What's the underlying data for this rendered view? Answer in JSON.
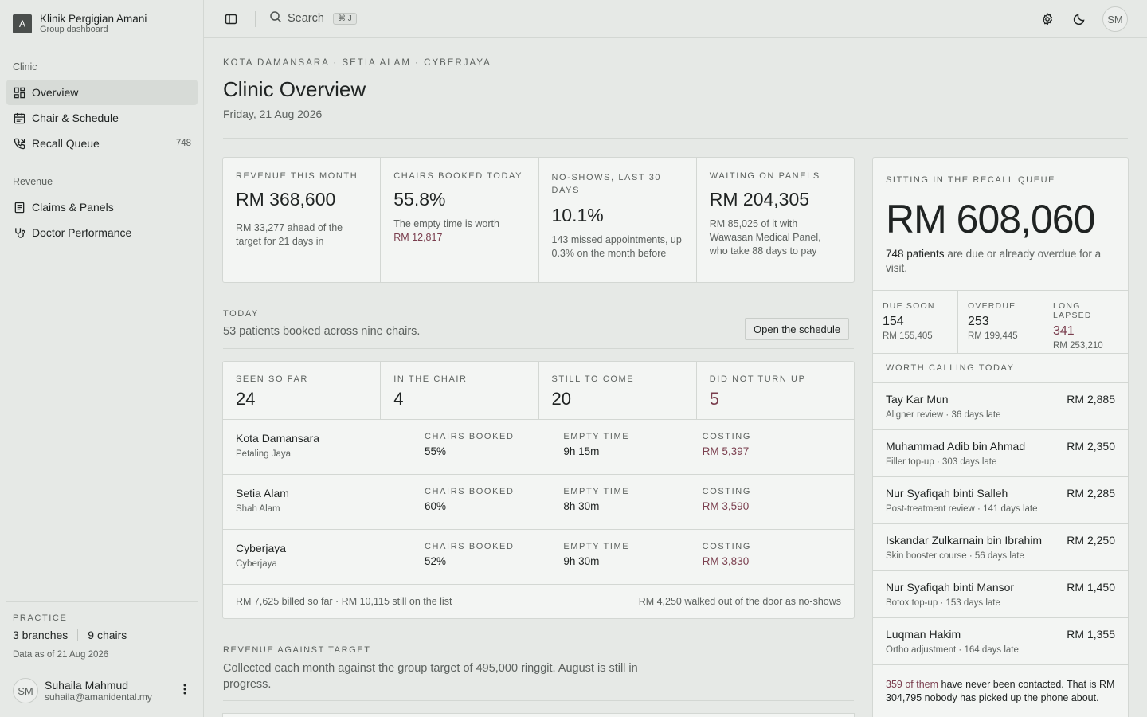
{
  "brand": {
    "logo_letter": "A",
    "name": "Klinik Pergigian Amani",
    "subtitle": "Group dashboard"
  },
  "sidebar": {
    "sections": [
      {
        "heading": "Clinic",
        "items": [
          {
            "label": "Overview",
            "icon": "grid-icon",
            "active": true
          },
          {
            "label": "Chair & Schedule",
            "icon": "calendar-icon"
          },
          {
            "label": "Recall Queue",
            "icon": "phone-icon",
            "count": "748"
          }
        ]
      },
      {
        "heading": "Revenue",
        "items": [
          {
            "label": "Claims & Panels",
            "icon": "document-icon"
          },
          {
            "label": "Doctor Performance",
            "icon": "stethoscope-icon"
          }
        ]
      }
    ],
    "practice": {
      "heading": "PRACTICE",
      "branches": "3 branches",
      "chairs": "9 chairs",
      "as_of": "Data as of 21 Aug 2026"
    },
    "user": {
      "initials": "SM",
      "name": "Suhaila Mahmud",
      "email": "suhaila@amanidental.my"
    }
  },
  "topbar": {
    "search_label": "Search",
    "shortcut": "⌘ J",
    "avatar_initials": "SM"
  },
  "page": {
    "breadcrumb": "KOTA DAMANSARA · SETIA ALAM · CYBERJAYA",
    "title": "Clinic Overview",
    "date": "Friday, 21 Aug 2026"
  },
  "kpis": [
    {
      "label": "REVENUE THIS MONTH",
      "value": "RM 368,600",
      "note": "RM 33,277 ahead of the target for 21 days in"
    },
    {
      "label": "CHAIRS BOOKED TODAY",
      "value": "55.8%",
      "note": "The empty time is worth",
      "note_accent": "RM 12,817"
    },
    {
      "label": "NO-SHOWS, LAST 30 DAYS",
      "value": "10.1%",
      "note": "143 missed appointments, up 0.3% on the month before"
    },
    {
      "label": "WAITING ON PANELS",
      "value": "RM 204,305",
      "note": "RM 85,025 of it with Wawasan Medical Panel, who take 88 days to pay"
    }
  ],
  "today": {
    "label": "TODAY",
    "subtitle": "53 patients booked across nine chairs.",
    "button": "Open the schedule",
    "stats": [
      {
        "label": "SEEN SO FAR",
        "value": "24"
      },
      {
        "label": "IN THE CHAIR",
        "value": "4"
      },
      {
        "label": "STILL TO COME",
        "value": "20"
      },
      {
        "label": "DID NOT TURN UP",
        "value": "5"
      }
    ],
    "col_labels": {
      "booked": "CHAIRS BOOKED",
      "empty": "EMPTY TIME",
      "costing": "COSTING"
    },
    "branches": [
      {
        "name": "Kota Damansara",
        "area": "Petaling Jaya",
        "booked": "55%",
        "empty": "9h 15m",
        "costing": "RM 5,397"
      },
      {
        "name": "Setia Alam",
        "area": "Shah Alam",
        "booked": "60%",
        "empty": "8h 30m",
        "costing": "RM 3,590"
      },
      {
        "name": "Cyberjaya",
        "area": "Cyberjaya",
        "booked": "52%",
        "empty": "9h 30m",
        "costing": "RM 3,830"
      }
    ],
    "footer_left": "RM 7,625 billed so far · RM 10,115 still on the list",
    "footer_right": "RM 4,250 walked out of the door as no-shows"
  },
  "revenue": {
    "label": "REVENUE AGAINST TARGET",
    "subtitle": "Collected each month against the group target of 495,000 ringgit. August is still in progress."
  },
  "recall": {
    "label": "SITTING IN THE RECALL QUEUE",
    "amount": "RM 608,060",
    "patients": "748 patients",
    "desc": " are due or already overdue for a visit.",
    "buckets": [
      {
        "label": "DUE SOON",
        "count": "154",
        "amount": "RM 155,405"
      },
      {
        "label": "OVERDUE",
        "count": "253",
        "amount": "RM 199,445"
      },
      {
        "label": "LONG LAPSED",
        "count": "341",
        "amount": "RM 253,210"
      }
    ],
    "worth_label": "WORTH CALLING TODAY",
    "patients_list": [
      {
        "name": "Tay Kar Mun",
        "amount": "RM 2,885",
        "treatment": "Aligner review",
        "late": "36 days late"
      },
      {
        "name": "Muhammad Adib bin Ahmad",
        "amount": "RM 2,350",
        "treatment": "Filler top-up",
        "late": "303 days late"
      },
      {
        "name": "Nur Syafiqah binti Salleh",
        "amount": "RM 2,285",
        "treatment": "Post-treatment review",
        "late": "141 days late"
      },
      {
        "name": "Iskandar Zulkarnain bin Ibrahim",
        "amount": "RM 2,250",
        "treatment": "Skin booster course",
        "late": "56 days late"
      },
      {
        "name": "Nur Syafiqah binti Mansor",
        "amount": "RM 1,450",
        "treatment": "Botox top-up",
        "late": "153 days late"
      },
      {
        "name": "Luqman Hakim",
        "amount": "RM 1,355",
        "treatment": "Ortho adjustment",
        "late": "164 days late"
      }
    ],
    "footer_accent": "359 of them",
    "footer_text": " have never been contacted. That is RM 304,795 nobody has picked up the phone about."
  },
  "colors": {
    "accent": "#7a3e4e",
    "background": "#e6e9e6",
    "card": "#f3f5f3"
  }
}
